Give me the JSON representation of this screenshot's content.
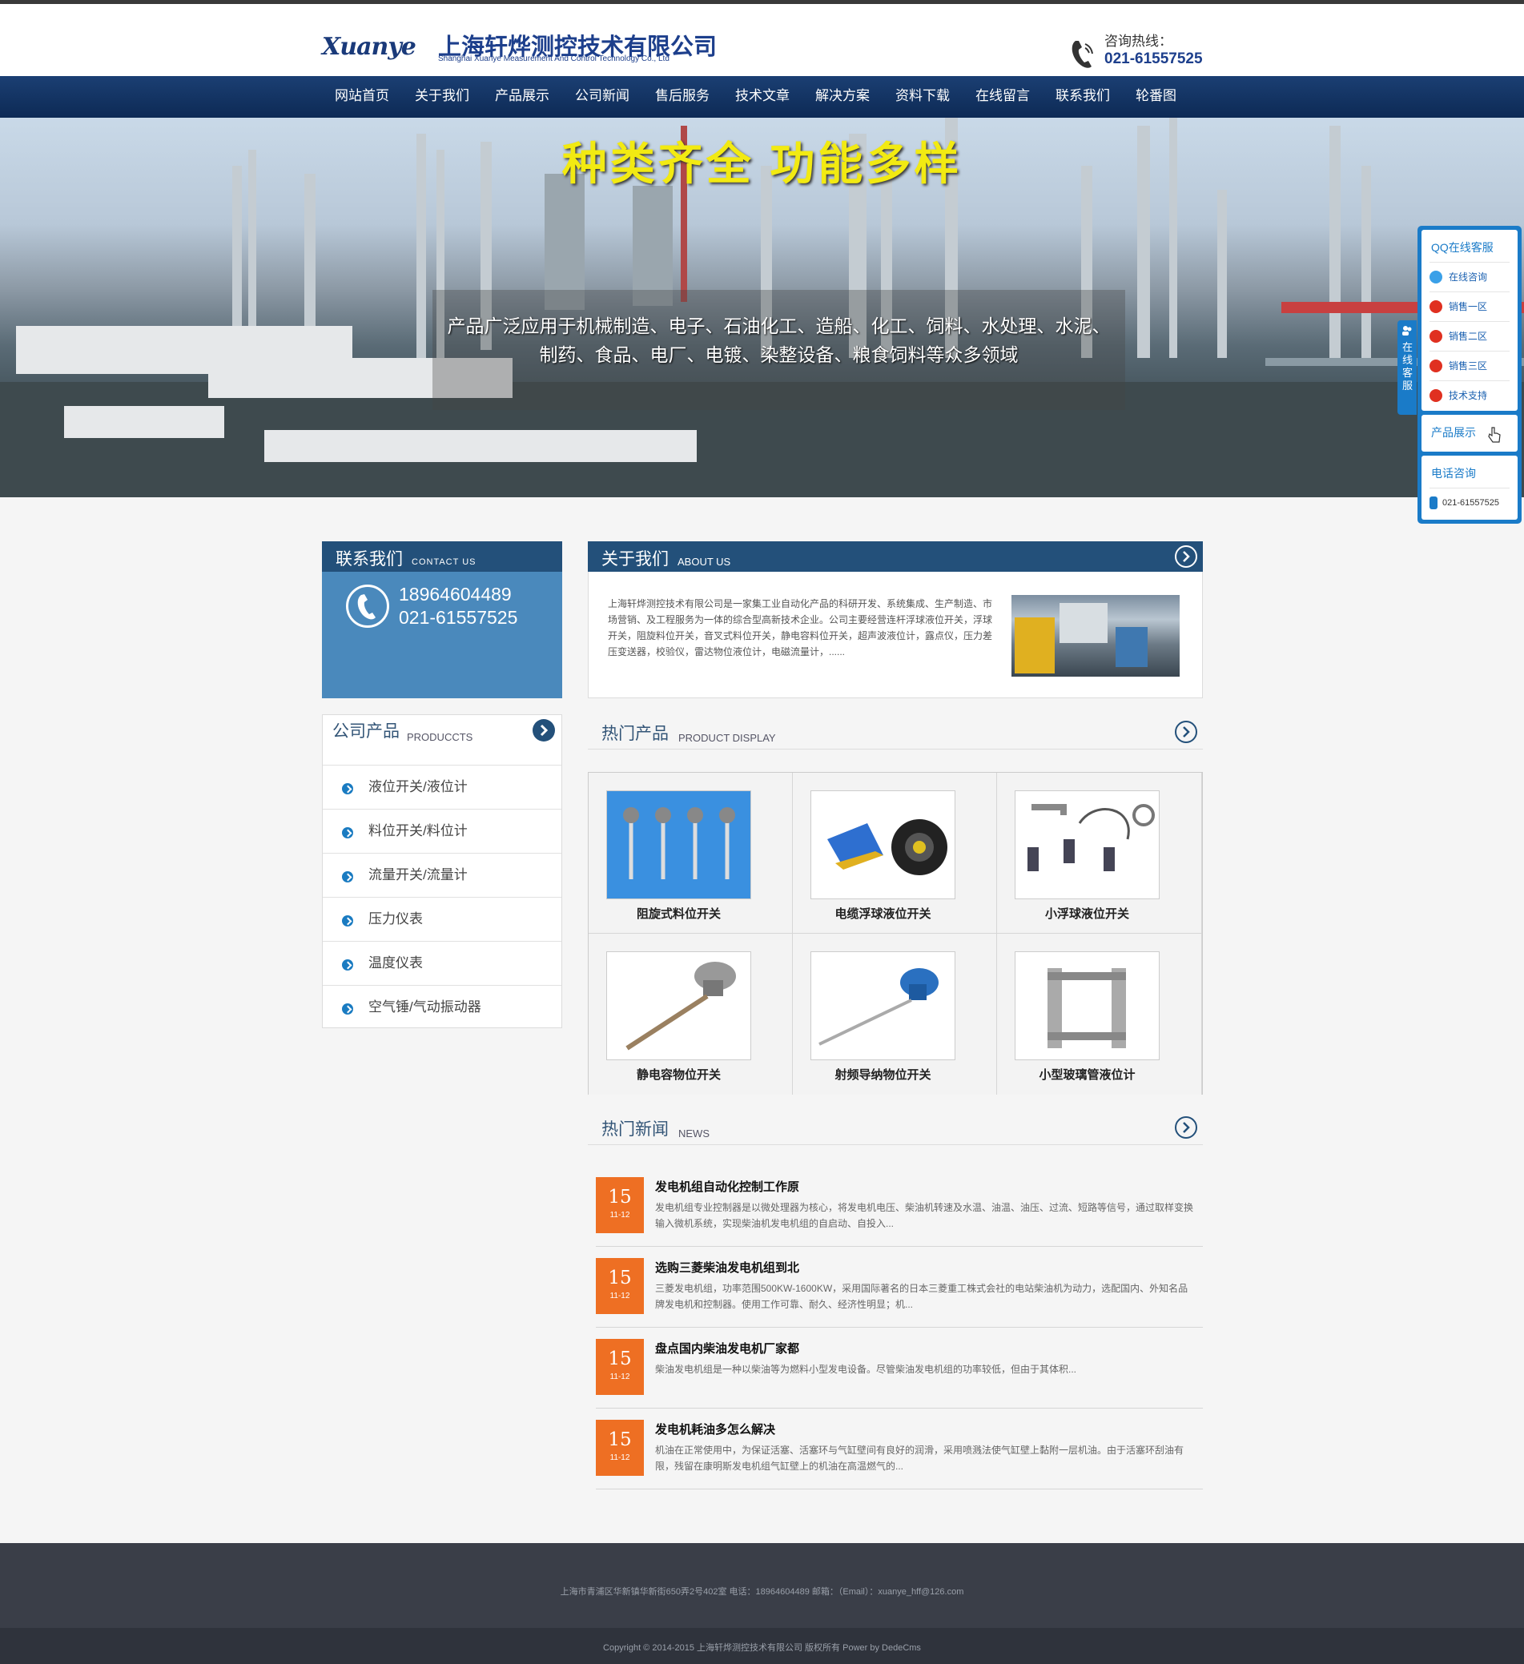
{
  "header": {
    "logo_mark": "Xuanye",
    "company_cn": "上海轩烨测控技术有限公司",
    "company_en": "Shanghai Xuanye Measurement And Control Technology  Co., Ltd",
    "hotline_label": "咨询热线：",
    "hotline_number": "021-61557525"
  },
  "nav": {
    "items": [
      "网站首页",
      "关于我们",
      "产品展示",
      "公司新闻",
      "售后服务",
      "技术文章",
      "解决方案",
      "资料下载",
      "在线留言",
      "联系我们",
      "轮番图"
    ]
  },
  "banner": {
    "title": "种类齐全 功能多样",
    "subtitle_line1": "产品广泛应用于机械制造、电子、石油化工、造船、化工、饲料、水处理、水泥、",
    "subtitle_line2": "制药、食品、电厂、电镀、染整设备、粮食饲料等众多领域"
  },
  "contact": {
    "title": "联系我们",
    "title_en": "CONTACT US",
    "phone1": "18964604489",
    "phone2": "021-61557525"
  },
  "products_menu": {
    "title": "公司产品",
    "title_en": "PRODUCCTS",
    "items": [
      "液位开关/液位计",
      "料位开关/料位计",
      "流量开关/流量计",
      "压力仪表",
      "温度仪表",
      "空气锤/气动振动器"
    ]
  },
  "about": {
    "title": "关于我们",
    "title_en": "ABOUT US",
    "text": "上海轩烨测控技术有限公司是一家集工业自动化产品的科研开发、系统集成、生产制造、市场营销、及工程服务为一体的综合型高新技术企业。公司主要经营连杆浮球液位开关，浮球开关，阻旋料位开关，音叉式料位开关，静电容料位开关，超声波液位计，露点仪，压力差压变送器，校验仪，雷达物位液位计，电磁流量计，......"
  },
  "hot_products": {
    "title": "热门产品",
    "title_en": "PRODUCT DISPLAY",
    "items": [
      {
        "name": "阻旋式料位开关",
        "icon": "rotary-level-switch"
      },
      {
        "name": "电缆浮球液位开关",
        "icon": "cable-float-switch"
      },
      {
        "name": "小浮球液位开关",
        "icon": "small-float-switch"
      },
      {
        "name": "静电容物位开关",
        "icon": "capacitive-level-switch"
      },
      {
        "name": "射频导纳物位开关",
        "icon": "rf-admittance-switch"
      },
      {
        "name": "小型玻璃管液位计",
        "icon": "glass-tube-gauge"
      }
    ]
  },
  "news": {
    "title": "热门新闻",
    "title_en": "NEWS",
    "items": [
      {
        "day": "15",
        "md": "11-12",
        "title": "发电机组自动化控制工作原",
        "desc": "发电机组专业控制器是以微处理器为核心，将发电机电压、柴油机转速及水温、油温、油压、过流、短路等信号，通过取样变换输入微机系统，实现柴油机发电机组的自启动、自投入..."
      },
      {
        "day": "15",
        "md": "11-12",
        "title": "选购三菱柴油发电机组到北",
        "desc": "三菱发电机组，功率范围500KW-1600KW，采用国际著名的日本三菱重工株式会社的电站柴油机为动力，选配国内、外知名品牌发电机和控制器。使用工作可靠、耐久、经济性明显；机..."
      },
      {
        "day": "15",
        "md": "11-12",
        "title": "盘点国内柴油发电机厂家都",
        "desc": "柴油发电机组是一种以柴油等为燃料小型发电设备。尽管柴油发电机组的功率较低，但由于其体积..."
      },
      {
        "day": "15",
        "md": "11-12",
        "title": "发电机耗油多怎么解决",
        "desc": "机油在正常使用中，为保证活塞、活塞环与气缸壁间有良好的润滑，采用喷溅法使气缸壁上黏附一层机油。由于活塞环刮油有限，残留在康明斯发电机组气缸壁上的机油在高温燃气的..."
      }
    ]
  },
  "footer": {
    "address": "上海市青浦区华新镇华新街650弄2号402室  电话：18964604489  邮箱：（Email）：xuanye_hff@126.com",
    "copyright": "Copyright © 2014-2015 上海轩烨测控技术有限公司 版权所有 Power by DedeCms"
  },
  "side_service": {
    "tab_label": "在线客服",
    "qq_title": "QQ在线客服",
    "qq_items": [
      "在线咨询",
      "销售一区",
      "销售二区",
      "销售三区",
      "技术支持"
    ],
    "product_label": "产品展示",
    "phone_title": "电话咨询",
    "phone": "021-61557525"
  },
  "colors": {
    "nav": "#173a6b",
    "accent_blue": "#23507a",
    "contact_blue": "#4a89bc",
    "news_orange": "#ee6f23",
    "banner_yellow": "#f2ea12",
    "side_blue": "#1a7bc8"
  }
}
